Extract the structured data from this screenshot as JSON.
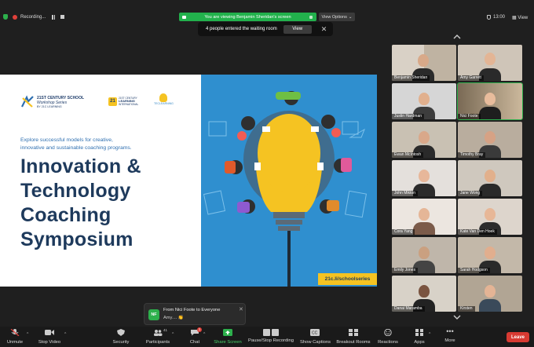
{
  "topbar": {
    "recording_label": "Recording...",
    "viewing_banner": "You are viewing Benjamin Sheridan's screen",
    "view_options_label": "View Options",
    "clock": "13:00",
    "view_label": "View",
    "waiting_room_text": "4 people entered the waiting room",
    "waiting_room_button": "View"
  },
  "slide": {
    "logo1_line1": "21ST CENTURY SCHOOL",
    "logo1_line2": "Workshop Series",
    "logo1_line3": "BY 21C LEARNING",
    "logo2_mark": "21",
    "logo2_line1": "21ST CENTURY",
    "logo2_line2": "LEARNING",
    "logo2_line3": "INTERNATIONAL",
    "logo3_text": "TECLEARNING",
    "explore_line1": "Explore successful models for creative,",
    "explore_line2": "innovative and sustainable coaching programs.",
    "title_lines": [
      "Innovation &",
      "Technology",
      "Coaching",
      "Symposium"
    ],
    "url": "21c.li/schoolseries"
  },
  "gallery": {
    "participants": [
      {
        "name": "Benjamin Sheridan"
      },
      {
        "name": "Amy Garrett"
      },
      {
        "name": "Justin Hardman"
      },
      {
        "name": "Nici Foote"
      },
      {
        "name": "Ewan McIntosh"
      },
      {
        "name": "Timothy Bray"
      },
      {
        "name": "John Mikton"
      },
      {
        "name": "Jane Wong"
      },
      {
        "name": "Cora Yang"
      },
      {
        "name": "Kate Van Den Hoek"
      },
      {
        "name": "Emily Jones"
      },
      {
        "name": "Sarah Hodgson"
      },
      {
        "name": "Danai Maramba"
      },
      {
        "name": "Kirsten"
      }
    ]
  },
  "chat_popup": {
    "avatar_initials": "NF",
    "from": "From Nici Foote to Everyone",
    "message": "Amy.... 👏"
  },
  "toolbar": {
    "unmute": "Unmute",
    "stop_video": "Stop Video",
    "security": "Security",
    "participants": "Participants",
    "participants_count": "41",
    "chat": "Chat",
    "chat_badge": "1",
    "share_screen": "Share Screen",
    "pause_stop_recording": "Pause/Stop Recording",
    "show_captions": "Show Captions",
    "breakout_rooms": "Breakout Rooms",
    "reactions": "Reactions",
    "apps": "Apps",
    "more": "More",
    "leave": "Leave"
  },
  "colors": {
    "accent_green": "#22b14c",
    "leave_red": "#d83a32",
    "slide_blue": "#2f8fcf",
    "title_navy": "#1e3a5c",
    "bulb_yellow": "#f5c322"
  }
}
